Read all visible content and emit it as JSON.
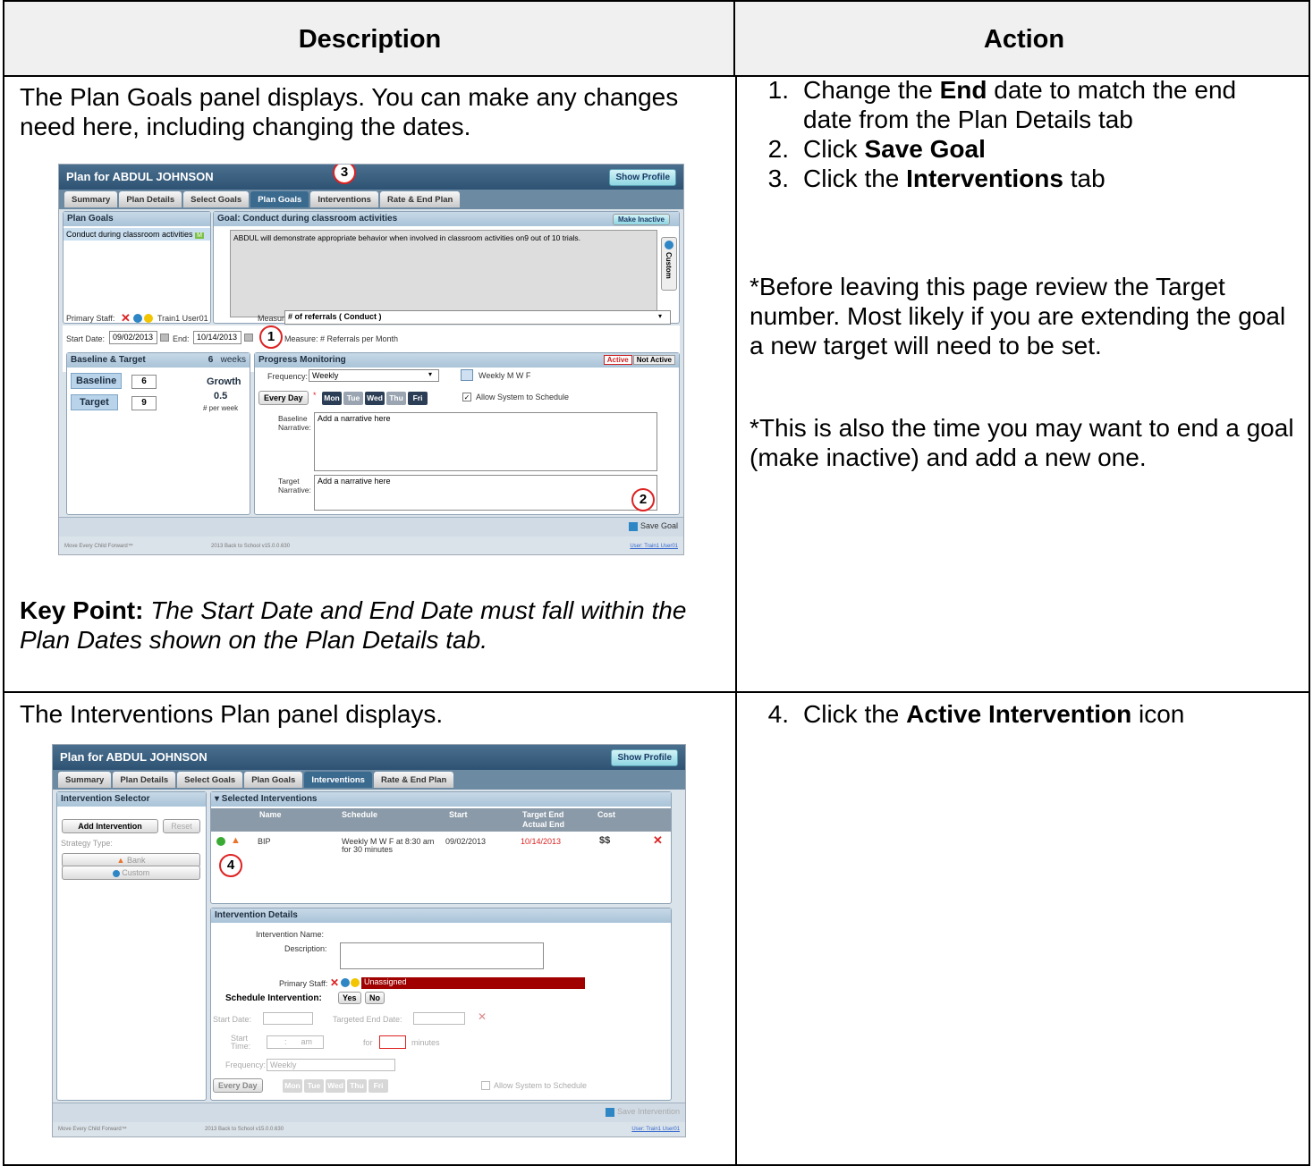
{
  "table": {
    "header_description": "Description",
    "header_action": "Action"
  },
  "row1": {
    "description": "The Plan Goals panel displays. You can make any changes need here, including changing the dates.",
    "key_point_label": "Key Point:",
    "key_point_text": "The Start Date and End Date must fall within the Plan Dates shown on the Plan Details tab.",
    "steps": [
      {
        "num": "1.",
        "pre": "Change the ",
        "bold": "End",
        "post": " date to match the end date from the Plan Details tab"
      },
      {
        "num": "2.",
        "pre": "Click ",
        "bold": "Save Goal",
        "post": ""
      },
      {
        "num": "3.",
        "pre": "Click the ",
        "bold": "Interventions",
        "post": " tab"
      }
    ],
    "note1": "*Before leaving this page review the Target number. Most likely if you are extending the goal a new target will need to be set.",
    "note2": "*This is also the time you may want to end a goal (make inactive) and add a new one."
  },
  "row2": {
    "description": "The Interventions Plan panel displays.",
    "steps": [
      {
        "num": "4.",
        "pre": "Click the ",
        "bold": "Active Intervention",
        "post": " icon"
      }
    ]
  },
  "shot1": {
    "title": "Plan for ABDUL JOHNSON",
    "show_profile": "Show Profile",
    "tabs": [
      "Summary",
      "Plan Details",
      "Select Goals",
      "Plan Goals",
      "Interventions",
      "Rate & End Plan"
    ],
    "active_tab": "Plan Goals",
    "plan_goals_header": "Plan Goals",
    "goal_item": "Conduct during classroom activities",
    "goal_header": "Goal:  Conduct during classroom activities",
    "make_inactive": "Make Inactive",
    "goal_text": "ABDUL will demonstrate appropriate behavior when involved in classroom activities on9 out of 10 trials.",
    "custom": "Custom",
    "primary_staff_label": "Primary Staff:",
    "primary_staff_value": "Train1 User01",
    "measure_label": "Measure:",
    "measure_value": "# of referrals ( Conduct )",
    "start_date_label": "Start Date:",
    "start_date": "09/02/2013",
    "end_label": "End:",
    "end_date": "10/14/2013",
    "measure2": "Measure:  # Referrals per Month",
    "baseline_target_header": "Baseline & Target",
    "weeks_num": "6",
    "weeks": "weeks",
    "baseline_label": "Baseline",
    "baseline_value": "6",
    "target_label": "Target",
    "target_value": "9",
    "growth_label": "Growth",
    "growth_value": "0.5",
    "per_week": "# per week",
    "progress_header": "Progress Monitoring",
    "active": "Active",
    "not_active": "Not Active",
    "frequency_label": "Frequency:",
    "frequency_value": "Weekly",
    "schedule_text": "Weekly M W F",
    "every_day": "Every Day",
    "days": [
      "Mon",
      "Tue",
      "Wed",
      "Thu",
      "Fri"
    ],
    "allow_schedule": "Allow System to Schedule",
    "baseline_narrative_label": "Baseline Narrative:",
    "target_narrative_label": "Target Narrative:",
    "narrative_placeholder": "Add a narrative here",
    "save_goal": "Save Goal",
    "footer_left": "Move Every Child Forward™",
    "footer_mid": "2013 Back to School v15.0.0.630",
    "footer_right": "User: Train1 User01",
    "callouts": [
      "3",
      "1",
      "2"
    ]
  },
  "shot2": {
    "title": "Plan for ABDUL JOHNSON",
    "show_profile": "Show Profile",
    "tabs": [
      "Summary",
      "Plan Details",
      "Select Goals",
      "Plan Goals",
      "Interventions",
      "Rate & End Plan"
    ],
    "active_tab": "Interventions",
    "selector_header": "Intervention Selector",
    "add_intervention": "Add Intervention",
    "reset": "Reset",
    "strategy_type": "Strategy Type:",
    "bank": "Bank",
    "custom": "Custom",
    "selected_header": "▾ Selected Interventions",
    "columns": [
      "Name",
      "Schedule",
      "Start",
      "Target End",
      "Cost"
    ],
    "actual_end": "Actual End",
    "row_name": "BIP",
    "row_schedule_1": "Weekly M W F at 8:30 am",
    "row_schedule_2": "for 30 minutes",
    "row_start": "09/02/2013",
    "row_target_end": "10/14/2013",
    "row_cost": "$$",
    "details_header": "Intervention Details",
    "intervention_name_label": "Intervention Name:",
    "description_label": "Description:",
    "primary_staff_label": "Primary Staff:",
    "unassigned": "Unassigned",
    "schedule_intervention": "Schedule Intervention:",
    "yes": "Yes",
    "no": "No",
    "start_date_label": "Start Date:",
    "targeted_end_label": "Targeted End Date:",
    "start_label": "Start",
    "time_label": "Time:",
    "time_colon": ":",
    "am": "am",
    "for": "for",
    "minutes": "minutes",
    "frequency_label": "Frequency:",
    "frequency_value": "Weekly",
    "every_day": "Every Day",
    "days": [
      "Mon",
      "Tue",
      "Wed",
      "Thu",
      "Fri"
    ],
    "allow_schedule": "Allow System to Schedule",
    "save_intervention": "Save Intervention",
    "footer_left": "Move Every Child Forward™",
    "footer_mid": "2013 Back to School v15.0.0.630",
    "footer_right": "User: Train1 User01",
    "callout": "4"
  },
  "colors": {
    "callout": "#dd2222",
    "header_bg": "#f0f0f0",
    "app_title_bar": "#2e5273",
    "unassigned_bg": "#a00000"
  }
}
